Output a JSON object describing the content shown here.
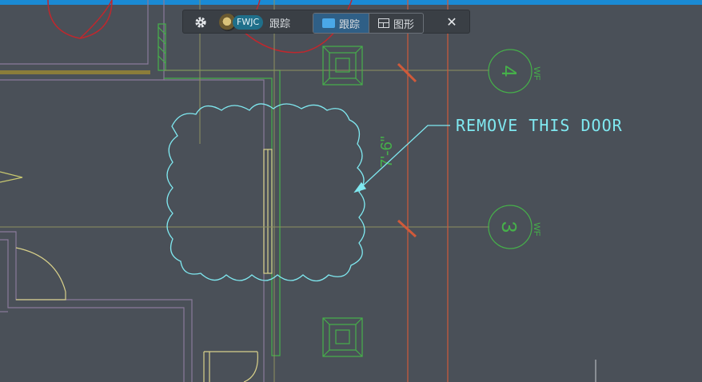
{
  "toolbar": {
    "settings_icon": "gear-icon",
    "user_initials": "FWJC",
    "trace_label": "跟踪",
    "modes": [
      {
        "label": "跟踪",
        "icon": "trace-icon",
        "active": true
      },
      {
        "label": "图形",
        "icon": "shape-icon",
        "active": false
      }
    ],
    "close_label": "✕"
  },
  "drawing": {
    "note_text": "REMOVE THIS DOOR",
    "dimension_text": "7'-6\"",
    "gridline_top": {
      "number": "4",
      "tag": "WF"
    },
    "gridline_bottom": {
      "number": "3",
      "tag": "WF"
    }
  },
  "colors": {
    "background": "#4a5058",
    "accent_bar": "#1a8ad4",
    "cloud": "#7fe8f0",
    "grid_bubbles": "#46b04a",
    "walls": "#8a7a9a",
    "red_grid": "#d05a3a"
  }
}
